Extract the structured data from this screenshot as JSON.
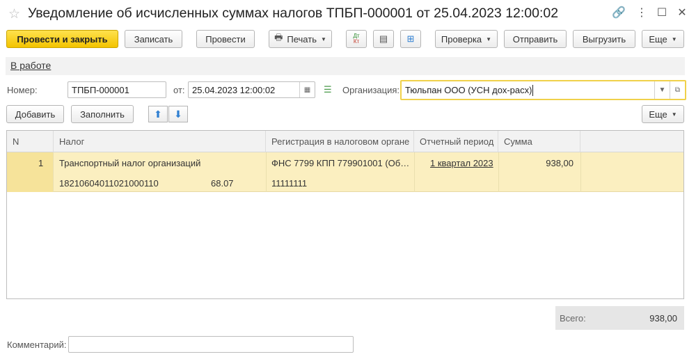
{
  "window": {
    "title": "Уведомление об исчисленных суммах налогов ТПБП-000001 от 25.04.2023 12:00:02",
    "link_icon": "🔗",
    "more_icon": "⋮",
    "minimize_icon": "☐",
    "close_icon": "✕"
  },
  "toolbar": {
    "post_close": "Провести и закрыть",
    "save": "Записать",
    "post": "Провести",
    "print": "Печать",
    "dtkt_top": "Дт",
    "dtkt_bottom": "Кт",
    "check": "Проверка",
    "send": "Отправить",
    "export": "Выгрузить",
    "more": "Еще"
  },
  "status": {
    "text": "В работе"
  },
  "form": {
    "number_label": "Номер:",
    "number_value": "ТПБП-000001",
    "date_label": "от:",
    "date_value": "25.04.2023 12:00:02",
    "org_label": "Организация:",
    "org_value": "Тюльпан ООО (УСН дох-расх)"
  },
  "table_toolbar": {
    "add": "Добавить",
    "fill": "Заполнить",
    "more": "Еще"
  },
  "table": {
    "columns": [
      "N",
      "Налог",
      "Регистрация в налоговом органе",
      "Отчетный период",
      "Сумма"
    ],
    "rows": [
      {
        "n": "1",
        "tax": "Транспортный налог организаций",
        "kbk": "18210604011021000110",
        "oktmo_code": "68.07",
        "registration": "ФНС 7799 КПП 779901001 (Об…",
        "oktmo": "11111111",
        "period": "1 квартал 2023",
        "amount": "938,00"
      }
    ]
  },
  "totals": {
    "label": "Всего:",
    "value": "938,00"
  },
  "comment": {
    "label": "Комментарий:",
    "value": ""
  }
}
